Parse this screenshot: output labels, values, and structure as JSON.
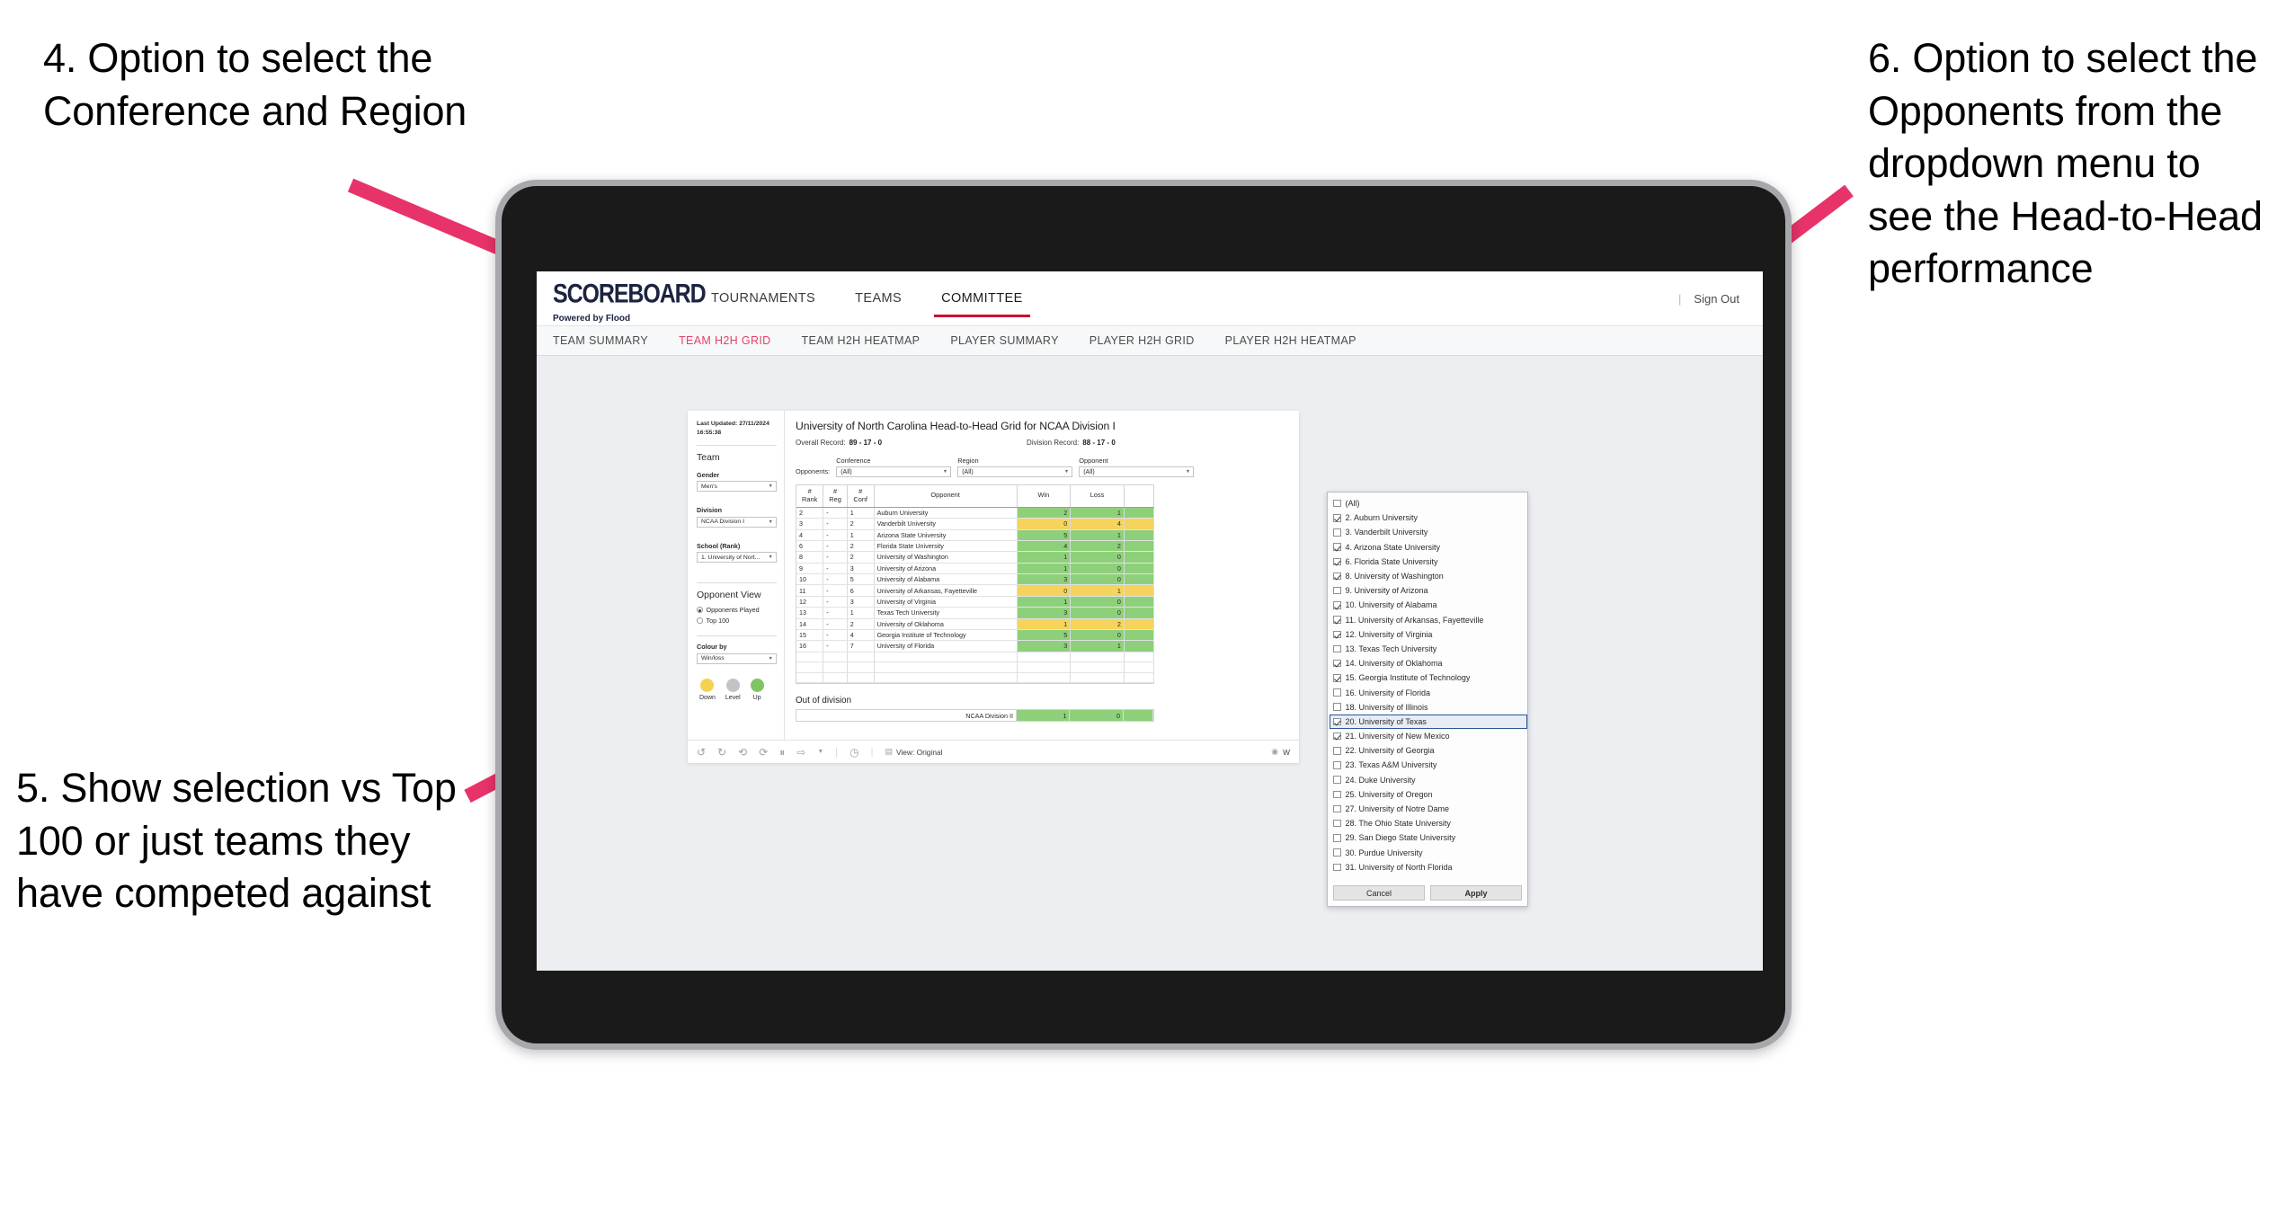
{
  "annotations": {
    "a4": "4. Option to select the Conference and Region",
    "a5": "5. Show selection vs Top 100 or just teams they have competed against",
    "a6": "6. Option to select the Opponents from the dropdown menu to see the Head-to-Head performance",
    "arrow_color": "#e8336a"
  },
  "topnav": {
    "logo": "SCOREBOARD",
    "tagline": "Powered by Flood",
    "items": [
      {
        "label": "TOURNAMENTS",
        "active": false
      },
      {
        "label": "TEAMS",
        "active": false
      },
      {
        "label": "COMMITTEE",
        "active": true
      }
    ],
    "divider": "|",
    "signout": "Sign Out"
  },
  "subnav": {
    "items": [
      {
        "label": "TEAM SUMMARY",
        "active": false
      },
      {
        "label": "TEAM H2H GRID",
        "active": true
      },
      {
        "label": "TEAM H2H HEATMAP",
        "active": false
      },
      {
        "label": "PLAYER SUMMARY",
        "active": false
      },
      {
        "label": "PLAYER H2H GRID",
        "active": false
      },
      {
        "label": "PLAYER H2H HEATMAP",
        "active": false
      }
    ],
    "active_color": "#e8406a"
  },
  "sidebar": {
    "last_updated": "Last Updated: 27/11/2024 16:55:38",
    "team_heading": "Team",
    "gender_label": "Gender",
    "gender_value": "Men's",
    "division_label": "Division",
    "division_value": "NCAA Division I",
    "school_label": "School (Rank)",
    "school_value": "1. University of Nort...",
    "opponent_view_heading": "Opponent View",
    "radio_options": [
      {
        "label": "Opponents Played",
        "selected": true
      },
      {
        "label": "Top 100",
        "selected": false
      }
    ],
    "colour_by_label": "Colour by",
    "colour_by_value": "Win/loss",
    "legend": [
      {
        "label": "Down",
        "color": "#f5d24e"
      },
      {
        "label": "Level",
        "color": "#c0c4c7"
      },
      {
        "label": "Up",
        "color": "#7ec563"
      }
    ]
  },
  "main": {
    "title": "University of North Carolina Head-to-Head Grid for NCAA Division I",
    "overall_record_label": "Overall Record:",
    "overall_record_value": "89 - 17 - 0",
    "division_record_label": "Division Record:",
    "division_record_value": "88 - 17 - 0",
    "opponents_label": "Opponents:",
    "filters": [
      {
        "caption": "Conference",
        "value": "(All)"
      },
      {
        "caption": "Region",
        "value": "(All)"
      },
      {
        "caption": "Opponent",
        "value": "(All)"
      }
    ],
    "out_of_division_title": "Out of division",
    "out_of_division_row": {
      "label": "NCAA Division II",
      "win": "1",
      "loss": "0"
    }
  },
  "chart_data": {
    "type": "table",
    "title": "University of North Carolina Head-to-Head Grid for NCAA Division I",
    "columns": [
      "# Rank",
      "# Reg",
      "# Conf",
      "Opponent",
      "Win",
      "Loss",
      ""
    ],
    "rows": [
      {
        "rank": "2",
        "reg": "-",
        "conf": "1",
        "opponent": "Auburn University",
        "win": "2",
        "loss": "1",
        "state": "up"
      },
      {
        "rank": "3",
        "reg": "-",
        "conf": "2",
        "opponent": "Vanderbilt University",
        "win": "0",
        "loss": "4",
        "state": "down"
      },
      {
        "rank": "4",
        "reg": "-",
        "conf": "1",
        "opponent": "Arizona State University",
        "win": "5",
        "loss": "1",
        "state": "up"
      },
      {
        "rank": "6",
        "reg": "-",
        "conf": "2",
        "opponent": "Florida State University",
        "win": "4",
        "loss": "2",
        "state": "up"
      },
      {
        "rank": "8",
        "reg": "-",
        "conf": "2",
        "opponent": "University of Washington",
        "win": "1",
        "loss": "0",
        "state": "up"
      },
      {
        "rank": "9",
        "reg": "-",
        "conf": "3",
        "opponent": "University of Arizona",
        "win": "1",
        "loss": "0",
        "state": "up"
      },
      {
        "rank": "10",
        "reg": "-",
        "conf": "5",
        "opponent": "University of Alabama",
        "win": "3",
        "loss": "0",
        "state": "up"
      },
      {
        "rank": "11",
        "reg": "-",
        "conf": "6",
        "opponent": "University of Arkansas, Fayetteville",
        "win": "0",
        "loss": "1",
        "state": "down"
      },
      {
        "rank": "12",
        "reg": "-",
        "conf": "3",
        "opponent": "University of Virginia",
        "win": "1",
        "loss": "0",
        "state": "up"
      },
      {
        "rank": "13",
        "reg": "-",
        "conf": "1",
        "opponent": "Texas Tech University",
        "win": "3",
        "loss": "0",
        "state": "up"
      },
      {
        "rank": "14",
        "reg": "-",
        "conf": "2",
        "opponent": "University of Oklahoma",
        "win": "1",
        "loss": "2",
        "state": "down"
      },
      {
        "rank": "15",
        "reg": "-",
        "conf": "4",
        "opponent": "Georgia Institute of Technology",
        "win": "5",
        "loss": "0",
        "state": "up"
      },
      {
        "rank": "16",
        "reg": "-",
        "conf": "7",
        "opponent": "University of Florida",
        "win": "3",
        "loss": "1",
        "state": "up"
      }
    ],
    "colors": {
      "up": "#8ed07a",
      "down": "#f6d35b"
    }
  },
  "opponent_dropdown": {
    "options": [
      {
        "label": "(All)",
        "checked": false,
        "highlighted": false
      },
      {
        "label": "2. Auburn University",
        "checked": true,
        "highlighted": false
      },
      {
        "label": "3. Vanderbilt University",
        "checked": false,
        "highlighted": false
      },
      {
        "label": "4. Arizona State University",
        "checked": true,
        "highlighted": false
      },
      {
        "label": "6. Florida State University",
        "checked": true,
        "highlighted": false
      },
      {
        "label": "8. University of Washington",
        "checked": true,
        "highlighted": false
      },
      {
        "label": "9. University of Arizona",
        "checked": false,
        "highlighted": false
      },
      {
        "label": "10. University of Alabama",
        "checked": true,
        "highlighted": false
      },
      {
        "label": "11. University of Arkansas, Fayetteville",
        "checked": true,
        "highlighted": false
      },
      {
        "label": "12. University of Virginia",
        "checked": true,
        "highlighted": false
      },
      {
        "label": "13. Texas Tech University",
        "checked": false,
        "highlighted": false
      },
      {
        "label": "14. University of Oklahoma",
        "checked": true,
        "highlighted": false
      },
      {
        "label": "15. Georgia Institute of Technology",
        "checked": true,
        "highlighted": false
      },
      {
        "label": "16. University of Florida",
        "checked": false,
        "highlighted": false
      },
      {
        "label": "18. University of Illinois",
        "checked": false,
        "highlighted": false
      },
      {
        "label": "20. University of Texas",
        "checked": true,
        "highlighted": true
      },
      {
        "label": "21. University of New Mexico",
        "checked": true,
        "highlighted": false
      },
      {
        "label": "22. University of Georgia",
        "checked": false,
        "highlighted": false
      },
      {
        "label": "23. Texas A&M University",
        "checked": false,
        "highlighted": false
      },
      {
        "label": "24. Duke University",
        "checked": false,
        "highlighted": false
      },
      {
        "label": "25. University of Oregon",
        "checked": false,
        "highlighted": false
      },
      {
        "label": "27. University of Notre Dame",
        "checked": false,
        "highlighted": false
      },
      {
        "label": "28. The Ohio State University",
        "checked": false,
        "highlighted": false
      },
      {
        "label": "29. San Diego State University",
        "checked": false,
        "highlighted": false
      },
      {
        "label": "30. Purdue University",
        "checked": false,
        "highlighted": false
      },
      {
        "label": "31. University of North Florida",
        "checked": false,
        "highlighted": false
      }
    ],
    "cancel_label": "Cancel",
    "apply_label": "Apply"
  },
  "toolbar": {
    "icons": [
      "undo-icon",
      "redo-icon",
      "revert-icon",
      "refresh-icon",
      "pause-icon",
      "share-icon"
    ],
    "view_label": "View: Original",
    "right_label": "W"
  }
}
